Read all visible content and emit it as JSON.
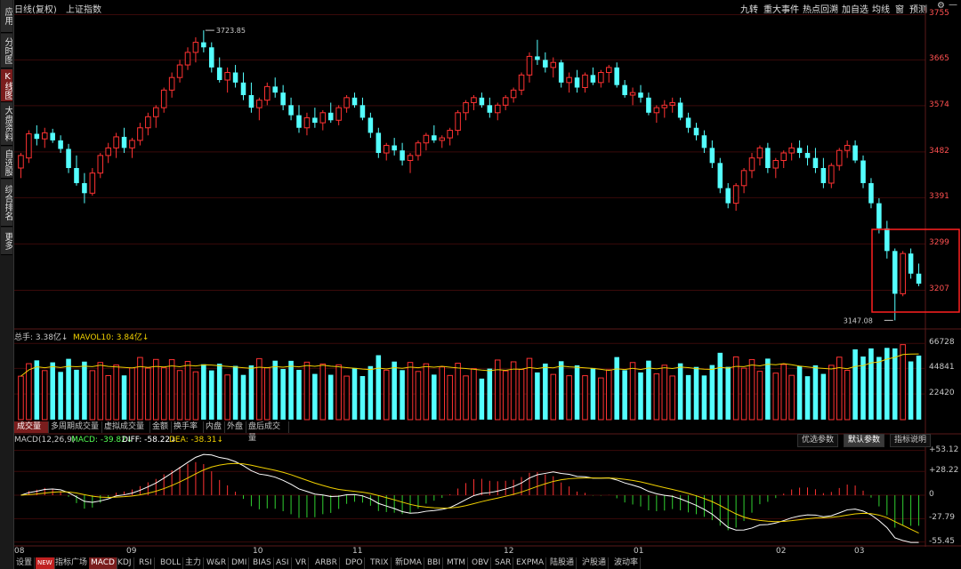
{
  "sidebar": {
    "items": [
      {
        "label": "应用",
        "active": false
      },
      {
        "label": "分时图",
        "active": false
      },
      {
        "label": "K线图",
        "active": true
      },
      {
        "label": "大盘资料",
        "active": false
      },
      {
        "label": "自选股",
        "active": false
      },
      {
        "label": "综合排名",
        "active": false
      },
      {
        "label": "更多",
        "active": false
      }
    ]
  },
  "header": {
    "period": "日线(复权)",
    "index_name": "上证指数",
    "tools": [
      "九转",
      "重大事件",
      "热点回溯",
      "加自选",
      "均线",
      "窗",
      "预测"
    ],
    "icons": [
      "gear-icon",
      "minimize-icon"
    ]
  },
  "price_axis": {
    "labels": [
      "3755",
      "3665",
      "3574",
      "3482",
      "3391",
      "3299",
      "3207"
    ]
  },
  "annotations": {
    "high": "3723.85",
    "low": "3147.08"
  },
  "volume": {
    "total_label": "总手: 3.38亿↓",
    "mavol_label": "MAVOL10: 3.84亿↓",
    "axis_labels": [
      "66728",
      "44841",
      "22420"
    ]
  },
  "volume_tabs": [
    {
      "label": "成交量",
      "active": true
    },
    {
      "label": "多周期成交量",
      "active": false
    },
    {
      "label": "虚拟成交量",
      "active": false
    },
    {
      "label": "金额",
      "active": false
    },
    {
      "label": "换手率",
      "active": false
    },
    {
      "label": "内盘",
      "active": false
    },
    {
      "label": "外盘",
      "active": false
    },
    {
      "label": "盘后成交量",
      "active": false
    }
  ],
  "macd": {
    "title": "MACD(12,26,9)",
    "macd_label": "MACD: -39.82↓",
    "diff_label": "DIFF: -58.22↓",
    "dea_label": "DEA: -38.31↓",
    "axis_labels": [
      "+53.12",
      "+28.22",
      "0",
      "-27.79",
      "-55.45"
    ],
    "param_tabs": [
      {
        "label": "优选参数",
        "active": false
      },
      {
        "label": "默认参数",
        "active": true
      },
      {
        "label": "指标说明",
        "active": false
      }
    ]
  },
  "x_axis": {
    "labels": [
      "08",
      "09",
      "10",
      "11",
      "12",
      "01",
      "02",
      "03"
    ]
  },
  "bottom_tabs": [
    {
      "label": "设置",
      "active": false
    },
    {
      "label": "NEW",
      "active": false
    },
    {
      "label": "指标广场",
      "active": false
    },
    {
      "label": "MACD",
      "active": true
    },
    {
      "label": "KDJ",
      "active": false
    },
    {
      "label": "RSI",
      "active": false
    },
    {
      "label": "BOLL",
      "active": false
    },
    {
      "label": "主力",
      "active": false
    },
    {
      "label": "W&R",
      "active": false
    },
    {
      "label": "DMI",
      "active": false
    },
    {
      "label": "BIAS",
      "active": false
    },
    {
      "label": "ASI",
      "active": false
    },
    {
      "label": "VR",
      "active": false
    },
    {
      "label": "ARBR",
      "active": false
    },
    {
      "label": "DPO",
      "active": false
    },
    {
      "label": "TRIX",
      "active": false
    },
    {
      "label": "新DMA",
      "active": false
    },
    {
      "label": "BBI",
      "active": false
    },
    {
      "label": "MTM",
      "active": false
    },
    {
      "label": "OBV",
      "active": false
    },
    {
      "label": "SAR",
      "active": false
    },
    {
      "label": "EXPMA",
      "active": false
    },
    {
      "label": "陆股通",
      "active": false
    },
    {
      "label": "沪股通",
      "active": false
    },
    {
      "label": "波动率",
      "active": false
    }
  ],
  "colors": {
    "up": "#ff3232",
    "down": "#54ffff",
    "ma": "#f0d000",
    "grid": "#3a0a0a",
    "highlight_box": "#ff2020"
  },
  "chart_data": {
    "type": "candlestick",
    "series": "上证指数",
    "ylim": [
      3147.08,
      3755
    ],
    "y_ticks": [
      3755,
      3665,
      3574,
      3482,
      3391,
      3299,
      3207
    ],
    "months": [
      "08",
      "09",
      "10",
      "11",
      "12",
      "01",
      "02",
      "03"
    ],
    "high": 3723.85,
    "low": 3147.08,
    "candles": [
      [
        3450,
        3480,
        3430,
        3475
      ],
      [
        3470,
        3525,
        3460,
        3518
      ],
      [
        3518,
        3535,
        3495,
        3508
      ],
      [
        3508,
        3530,
        3490,
        3520
      ],
      [
        3520,
        3528,
        3500,
        3505
      ],
      [
        3505,
        3515,
        3480,
        3488
      ],
      [
        3488,
        3498,
        3440,
        3450
      ],
      [
        3450,
        3475,
        3415,
        3420
      ],
      [
        3420,
        3440,
        3380,
        3400
      ],
      [
        3400,
        3450,
        3395,
        3440
      ],
      [
        3440,
        3480,
        3430,
        3475
      ],
      [
        3475,
        3500,
        3460,
        3490
      ],
      [
        3490,
        3520,
        3470,
        3512
      ],
      [
        3512,
        3530,
        3480,
        3490
      ],
      [
        3490,
        3510,
        3470,
        3505
      ],
      [
        3505,
        3540,
        3495,
        3530
      ],
      [
        3530,
        3560,
        3515,
        3552
      ],
      [
        3552,
        3575,
        3530,
        3570
      ],
      [
        3570,
        3610,
        3560,
        3605
      ],
      [
        3605,
        3640,
        3590,
        3630
      ],
      [
        3630,
        3665,
        3620,
        3655
      ],
      [
        3655,
        3690,
        3645,
        3680
      ],
      [
        3680,
        3710,
        3660,
        3700
      ],
      [
        3700,
        3723.85,
        3680,
        3690
      ],
      [
        3690,
        3700,
        3640,
        3650
      ],
      [
        3650,
        3670,
        3620,
        3625
      ],
      [
        3625,
        3650,
        3600,
        3640
      ],
      [
        3640,
        3655,
        3610,
        3620
      ],
      [
        3620,
        3640,
        3585,
        3595
      ],
      [
        3595,
        3620,
        3560,
        3570
      ],
      [
        3570,
        3590,
        3545,
        3585
      ],
      [
        3585,
        3620,
        3575,
        3612
      ],
      [
        3612,
        3630,
        3590,
        3600
      ],
      [
        3600,
        3615,
        3565,
        3575
      ],
      [
        3575,
        3590,
        3545,
        3555
      ],
      [
        3555,
        3575,
        3520,
        3530
      ],
      [
        3530,
        3560,
        3515,
        3550
      ],
      [
        3550,
        3570,
        3530,
        3540
      ],
      [
        3540,
        3565,
        3525,
        3560
      ],
      [
        3560,
        3580,
        3540,
        3545
      ],
      [
        3545,
        3575,
        3535,
        3570
      ],
      [
        3570,
        3595,
        3560,
        3590
      ],
      [
        3590,
        3600,
        3570,
        3575
      ],
      [
        3575,
        3590,
        3545,
        3550
      ],
      [
        3550,
        3560,
        3510,
        3520
      ],
      [
        3520,
        3530,
        3470,
        3480
      ],
      [
        3480,
        3500,
        3465,
        3495
      ],
      [
        3495,
        3510,
        3475,
        3485
      ],
      [
        3485,
        3500,
        3455,
        3465
      ],
      [
        3465,
        3480,
        3440,
        3475
      ],
      [
        3475,
        3505,
        3465,
        3500
      ],
      [
        3500,
        3520,
        3485,
        3515
      ],
      [
        3515,
        3535,
        3500,
        3505
      ],
      [
        3505,
        3515,
        3490,
        3510
      ],
      [
        3510,
        3530,
        3495,
        3525
      ],
      [
        3525,
        3565,
        3515,
        3560
      ],
      [
        3560,
        3585,
        3545,
        3580
      ],
      [
        3580,
        3595,
        3565,
        3590
      ],
      [
        3590,
        3600,
        3570,
        3575
      ],
      [
        3575,
        3590,
        3550,
        3560
      ],
      [
        3560,
        3580,
        3545,
        3575
      ],
      [
        3575,
        3595,
        3565,
        3590
      ],
      [
        3590,
        3610,
        3580,
        3605
      ],
      [
        3605,
        3640,
        3595,
        3635
      ],
      [
        3635,
        3680,
        3620,
        3672
      ],
      [
        3672,
        3705,
        3655,
        3665
      ],
      [
        3665,
        3680,
        3640,
        3650
      ],
      [
        3650,
        3670,
        3630,
        3660
      ],
      [
        3660,
        3665,
        3610,
        3620
      ],
      [
        3620,
        3640,
        3600,
        3630
      ],
      [
        3630,
        3645,
        3600,
        3610
      ],
      [
        3610,
        3640,
        3600,
        3635
      ],
      [
        3635,
        3650,
        3615,
        3620
      ],
      [
        3620,
        3645,
        3610,
        3640
      ],
      [
        3640,
        3655,
        3620,
        3650
      ],
      [
        3650,
        3660,
        3610,
        3615
      ],
      [
        3615,
        3625,
        3590,
        3595
      ],
      [
        3595,
        3610,
        3575,
        3600
      ],
      [
        3600,
        3615,
        3580,
        3590
      ],
      [
        3590,
        3600,
        3555,
        3560
      ],
      [
        3560,
        3575,
        3540,
        3570
      ],
      [
        3570,
        3585,
        3550,
        3575
      ],
      [
        3575,
        3590,
        3560,
        3580
      ],
      [
        3580,
        3590,
        3545,
        3550
      ],
      [
        3550,
        3560,
        3520,
        3530
      ],
      [
        3530,
        3540,
        3505,
        3515
      ],
      [
        3515,
        3525,
        3480,
        3490
      ],
      [
        3490,
        3505,
        3450,
        3460
      ],
      [
        3460,
        3470,
        3400,
        3410
      ],
      [
        3410,
        3420,
        3370,
        3380
      ],
      [
        3380,
        3420,
        3365,
        3415
      ],
      [
        3415,
        3450,
        3400,
        3445
      ],
      [
        3445,
        3480,
        3430,
        3470
      ],
      [
        3470,
        3495,
        3455,
        3490
      ],
      [
        3490,
        3500,
        3440,
        3450
      ],
      [
        3450,
        3470,
        3430,
        3465
      ],
      [
        3465,
        3485,
        3450,
        3480
      ],
      [
        3480,
        3500,
        3465,
        3490
      ],
      [
        3490,
        3505,
        3470,
        3480
      ],
      [
        3480,
        3495,
        3455,
        3470
      ],
      [
        3470,
        3490,
        3440,
        3450
      ],
      [
        3450,
        3470,
        3410,
        3420
      ],
      [
        3420,
        3460,
        3410,
        3455
      ],
      [
        3455,
        3490,
        3445,
        3485
      ],
      [
        3485,
        3505,
        3470,
        3495
      ],
      [
        3495,
        3505,
        3460,
        3465
      ],
      [
        3465,
        3475,
        3410,
        3420
      ],
      [
        3420,
        3430,
        3370,
        3380
      ],
      [
        3380,
        3390,
        3320,
        3330
      ],
      [
        3330,
        3345,
        3270,
        3285
      ],
      [
        3285,
        3290,
        3147.08,
        3200
      ],
      [
        3200,
        3285,
        3195,
        3280
      ],
      [
        3280,
        3290,
        3230,
        3240
      ],
      [
        3240,
        3260,
        3215,
        3220
      ]
    ],
    "volume_axis": [
      22420,
      44841,
      66728
    ],
    "macd_axis": [
      53.12,
      28.22,
      0,
      -27.79,
      -55.45
    ]
  }
}
